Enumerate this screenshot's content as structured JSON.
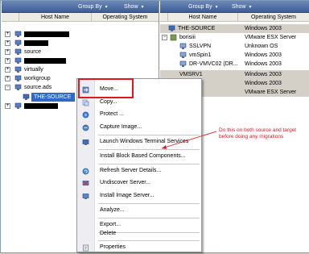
{
  "left_pane": {
    "toolbar": {
      "group_by": "Group By",
      "show": "Show"
    },
    "columns": {
      "host_name": "Host Name",
      "os": "Operating System"
    },
    "rows": [
      {
        "label": "source"
      },
      {
        "label": "virtually"
      },
      {
        "label": "workgroup"
      },
      {
        "label": "source.ads"
      },
      {
        "label": "THE-SOURCE"
      }
    ]
  },
  "right_pane": {
    "toolbar": {
      "group_by": "Group By",
      "show": "Show"
    },
    "columns": {
      "host_name": "Host Name",
      "os": "Operating System"
    },
    "rows": [
      {
        "host": "THE-SOURCE",
        "os": "Windows 2003"
      },
      {
        "host": "borisiii",
        "os": "VMware ESX Server"
      },
      {
        "host": "SSLVPN",
        "os": "Unknown OS"
      },
      {
        "host": "vmSpin1",
        "os": "Windows 2003"
      },
      {
        "host": "DR-VMVC02 (DR...",
        "os": "Windows 2003"
      },
      {
        "host": "VMSRV1",
        "os": "Windows 2003"
      },
      {
        "host": "",
        "os": "Windows 2003"
      },
      {
        "host": "",
        "os": "VMware ESX Server"
      }
    ]
  },
  "context_menu": {
    "items": [
      {
        "label": "Move...",
        "icon": "move-icon"
      },
      {
        "label": "Copy...",
        "icon": "copy-icon"
      },
      {
        "label": "Protect ...",
        "icon": "protect-icon"
      },
      {
        "label": "Capture Image...",
        "icon": "capture-icon"
      },
      {
        "label": "Launch Windows Terminal Services",
        "icon": "terminal-icon"
      },
      {
        "label": "Install Block Based Components...",
        "icon": ""
      },
      {
        "label": "Refresh Server Details...",
        "icon": "refresh-icon"
      },
      {
        "label": "Undiscover Server...",
        "icon": "undiscover-icon"
      },
      {
        "label": "Install Image Server...",
        "icon": "install-icon"
      },
      {
        "label": "Analyze...",
        "icon": ""
      },
      {
        "label": "Export...",
        "icon": ""
      },
      {
        "label": "Delete",
        "icon": ""
      },
      {
        "label": "Properties",
        "icon": "properties-icon"
      }
    ]
  },
  "annotation": {
    "text": "Do this on both source and target before doing any migrations",
    "color": "#e0181e"
  }
}
